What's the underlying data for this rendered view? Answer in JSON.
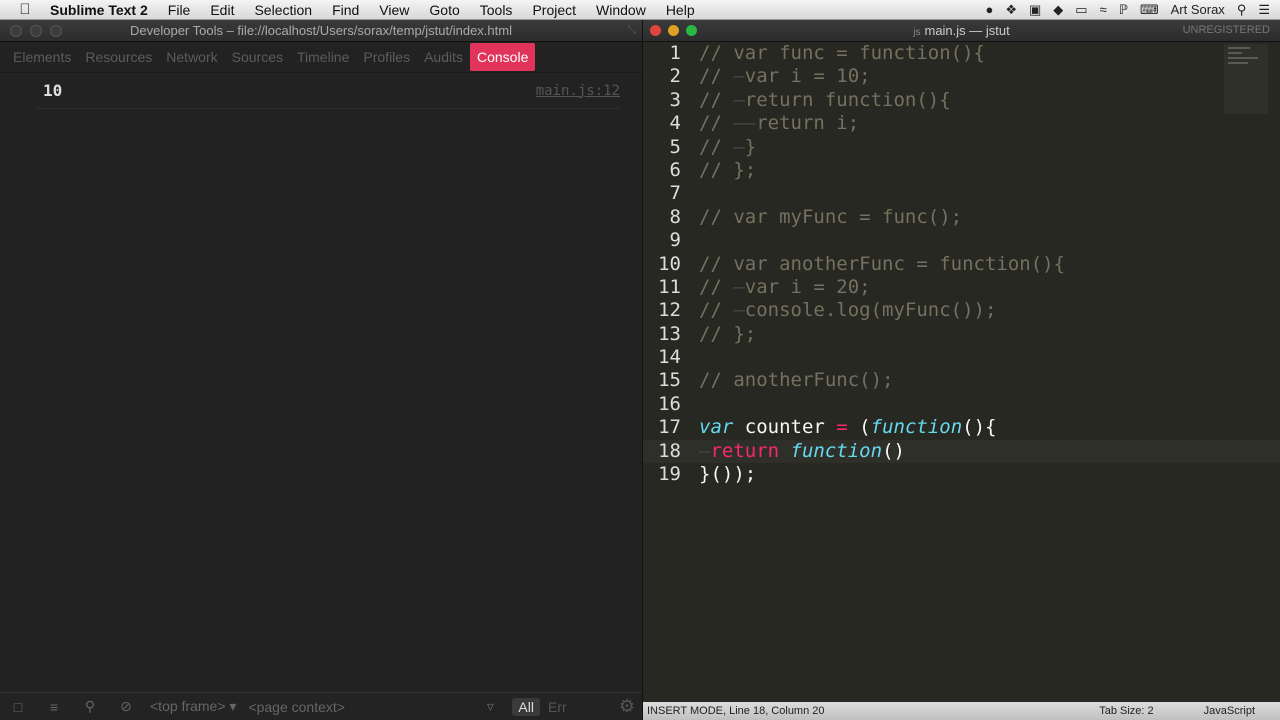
{
  "menubar": {
    "app": "Sublime Text 2",
    "items": [
      "File",
      "Edit",
      "Selection",
      "Find",
      "View",
      "Goto",
      "Tools",
      "Project",
      "Window",
      "Help"
    ],
    "user": "Art Sorax"
  },
  "devtools": {
    "title": "Developer Tools – file://localhost/Users/sorax/temp/jstut/index.html",
    "tabs": [
      "Elements",
      "Resources",
      "Network",
      "Sources",
      "Timeline",
      "Profiles",
      "Audits",
      "Console"
    ],
    "active_tab": "Console",
    "console": {
      "value": "10",
      "source": "main.js:12"
    },
    "bottom": {
      "frame": "<top frame>",
      "context": "<page context>",
      "filter_all": "All",
      "errors": "Err"
    }
  },
  "sublime": {
    "title": "main.js — jstut",
    "file_tag": "js",
    "unregistered": "UNREGISTERED",
    "lines": [
      {
        "n": "1",
        "text": "// var func = function(){"
      },
      {
        "n": "2",
        "text": "// →var i = 10;"
      },
      {
        "n": "3",
        "text": "// →return function(){"
      },
      {
        "n": "4",
        "text": "// →→return i;"
      },
      {
        "n": "5",
        "text": "// →}"
      },
      {
        "n": "6",
        "text": "// };"
      },
      {
        "n": "7",
        "text": ""
      },
      {
        "n": "8",
        "text": "// var myFunc = func();"
      },
      {
        "n": "9",
        "text": ""
      },
      {
        "n": "10",
        "text": "// var anotherFunc = function(){"
      },
      {
        "n": "11",
        "text": "// →var i = 20;"
      },
      {
        "n": "12",
        "text": "// →console.log(myFunc());"
      },
      {
        "n": "13",
        "text": "// };"
      },
      {
        "n": "14",
        "text": ""
      },
      {
        "n": "15",
        "text": "// anotherFunc();"
      },
      {
        "n": "16",
        "text": ""
      },
      {
        "n": "17",
        "text": "var counter = (function(){"
      },
      {
        "n": "18",
        "text": "→return function()"
      },
      {
        "n": "19",
        "text": "}());"
      }
    ],
    "status": {
      "mode": "INSERT MODE, Line 18, Column 20",
      "tab_size": "Tab Size: 2",
      "syntax": "JavaScript"
    }
  }
}
